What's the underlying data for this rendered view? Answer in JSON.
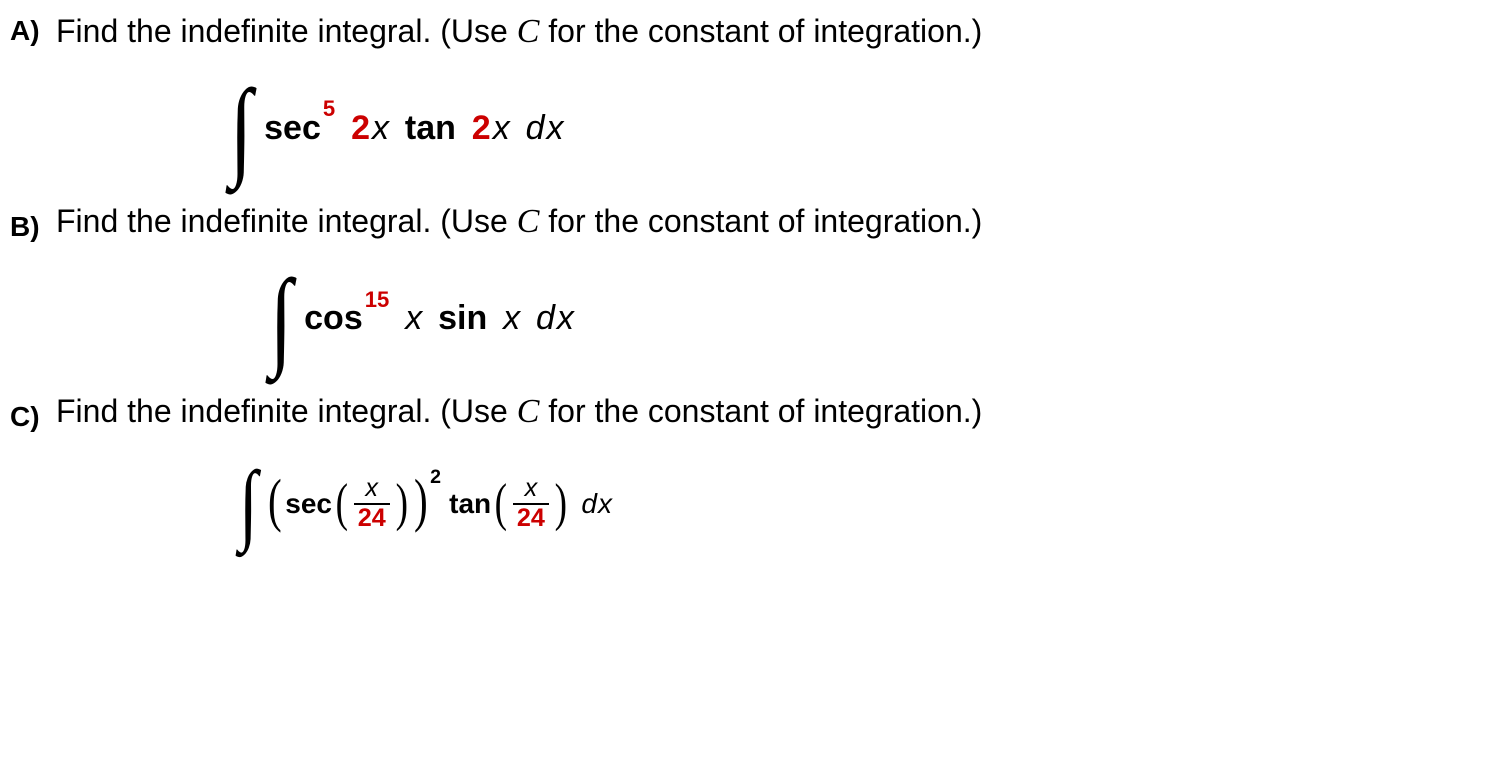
{
  "problems": {
    "a": {
      "label": "A)",
      "prompt_pre": "Find the indefinite integral. (Use ",
      "prompt_var": "C",
      "prompt_post": " for the constant of integration.)",
      "expr": {
        "sec": "sec",
        "exp5": "5",
        "two1": "2",
        "x1": "x",
        "tan": "tan",
        "two2": "2",
        "x2": "x",
        "dx_d": "d",
        "dx_x": "x"
      }
    },
    "b": {
      "label": "B)",
      "prompt_pre": "Find the indefinite integral. (Use ",
      "prompt_var": "C",
      "prompt_post": " for the constant of integration.)",
      "expr": {
        "cos": "cos",
        "exp15": "15",
        "x1": "x",
        "sin": "sin",
        "x2": "x",
        "dx_d": "d",
        "dx_x": "x"
      }
    },
    "c": {
      "label": "C)",
      "prompt_pre": "Find the indefinite integral. (Use ",
      "prompt_var": "C",
      "prompt_post": " for the constant of integration.)",
      "expr": {
        "sec": "sec",
        "frac1_num": "x",
        "frac1_den": "24",
        "outer_exp": "2",
        "tan": "tan",
        "frac2_num": "x",
        "frac2_den": "24",
        "dx_d": "d",
        "dx_x": "x"
      }
    }
  }
}
